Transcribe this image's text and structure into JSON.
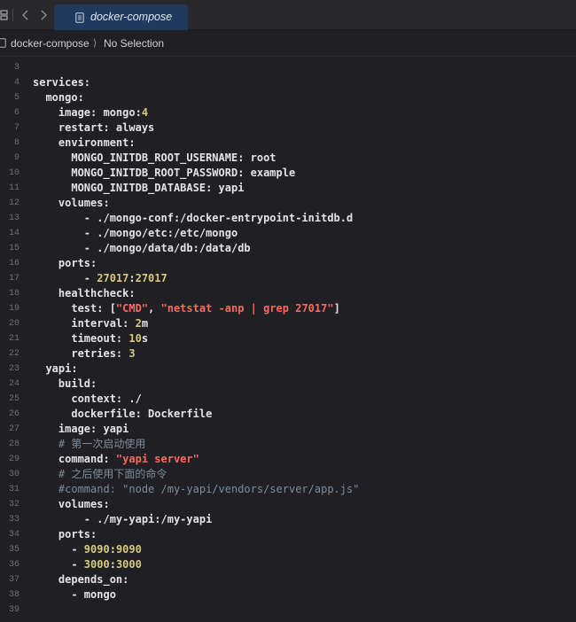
{
  "tab": {
    "title": "docker-compose"
  },
  "breadcrumb": {
    "file": "docker-compose",
    "separator": "⟩",
    "selection": "No Selection"
  },
  "lines": [
    {
      "no": "3",
      "segs": []
    },
    {
      "no": "4",
      "segs": [
        {
          "t": "services:",
          "k": "p"
        }
      ]
    },
    {
      "no": "5",
      "segs": [
        {
          "t": "  mongo:",
          "k": "p"
        }
      ]
    },
    {
      "no": "6",
      "segs": [
        {
          "t": "    image: mongo:",
          "k": "p"
        },
        {
          "t": "4",
          "k": "n"
        }
      ]
    },
    {
      "no": "7",
      "segs": [
        {
          "t": "    restart: always",
          "k": "p"
        }
      ]
    },
    {
      "no": "8",
      "segs": [
        {
          "t": "    environment:",
          "k": "p"
        }
      ]
    },
    {
      "no": "9",
      "segs": [
        {
          "t": "      MONGO_INITDB_ROOT_USERNAME: root",
          "k": "p"
        }
      ]
    },
    {
      "no": "10",
      "segs": [
        {
          "t": "      MONGO_INITDB_ROOT_PASSWORD: example",
          "k": "p"
        }
      ]
    },
    {
      "no": "11",
      "segs": [
        {
          "t": "      MONGO_INITDB_DATABASE: yapi",
          "k": "p"
        }
      ]
    },
    {
      "no": "12",
      "segs": [
        {
          "t": "    volumes:",
          "k": "p"
        }
      ]
    },
    {
      "no": "13",
      "segs": [
        {
          "t": "        - ./mongo-conf:/docker-entrypoint-initdb.d",
          "k": "p"
        }
      ]
    },
    {
      "no": "14",
      "segs": [
        {
          "t": "        - ./mongo/etc:/etc/mongo",
          "k": "p"
        }
      ]
    },
    {
      "no": "15",
      "segs": [
        {
          "t": "        - ./mongo/data/db:/data/db",
          "k": "p"
        }
      ]
    },
    {
      "no": "16",
      "segs": [
        {
          "t": "    ports:",
          "k": "p"
        }
      ]
    },
    {
      "no": "17",
      "segs": [
        {
          "t": "        - ",
          "k": "p"
        },
        {
          "t": "27017",
          "k": "n"
        },
        {
          "t": ":",
          "k": "p"
        },
        {
          "t": "27017",
          "k": "n"
        }
      ]
    },
    {
      "no": "18",
      "segs": [
        {
          "t": "    healthcheck:",
          "k": "p"
        }
      ]
    },
    {
      "no": "19",
      "segs": [
        {
          "t": "      test: [",
          "k": "p"
        },
        {
          "t": "\"CMD\"",
          "k": "s"
        },
        {
          "t": ", ",
          "k": "p"
        },
        {
          "t": "\"netstat -anp | grep 27017\"",
          "k": "s"
        },
        {
          "t": "]",
          "k": "p"
        }
      ]
    },
    {
      "no": "20",
      "segs": [
        {
          "t": "      interval: ",
          "k": "p"
        },
        {
          "t": "2",
          "k": "n"
        },
        {
          "t": "m",
          "k": "p"
        }
      ]
    },
    {
      "no": "21",
      "segs": [
        {
          "t": "      timeout: ",
          "k": "p"
        },
        {
          "t": "10",
          "k": "n"
        },
        {
          "t": "s",
          "k": "p"
        }
      ]
    },
    {
      "no": "22",
      "segs": [
        {
          "t": "      retries: ",
          "k": "p"
        },
        {
          "t": "3",
          "k": "n"
        }
      ]
    },
    {
      "no": "23",
      "segs": [
        {
          "t": "  yapi:",
          "k": "p"
        }
      ]
    },
    {
      "no": "24",
      "segs": [
        {
          "t": "    build:",
          "k": "p"
        }
      ]
    },
    {
      "no": "25",
      "segs": [
        {
          "t": "      context: ./",
          "k": "p"
        }
      ]
    },
    {
      "no": "26",
      "segs": [
        {
          "t": "      dockerfile: Dockerfile",
          "k": "p"
        }
      ]
    },
    {
      "no": "27",
      "segs": [
        {
          "t": "    image: yapi",
          "k": "p"
        }
      ]
    },
    {
      "no": "28",
      "segs": [
        {
          "t": "    # 第一次启动使用",
          "k": "c"
        }
      ]
    },
    {
      "no": "29",
      "segs": [
        {
          "t": "    command: ",
          "k": "p"
        },
        {
          "t": "\"yapi server\"",
          "k": "s"
        }
      ]
    },
    {
      "no": "30",
      "segs": [
        {
          "t": "    # 之后使用下面的命令",
          "k": "c"
        }
      ]
    },
    {
      "no": "31",
      "segs": [
        {
          "t": "    #command: \"node /my-yapi/vendors/server/app.js\"",
          "k": "c"
        }
      ]
    },
    {
      "no": "32",
      "segs": [
        {
          "t": "    volumes:",
          "k": "p"
        }
      ]
    },
    {
      "no": "33",
      "segs": [
        {
          "t": "        - ./my-yapi:/my-yapi",
          "k": "p"
        }
      ]
    },
    {
      "no": "34",
      "segs": [
        {
          "t": "    ports:",
          "k": "p"
        }
      ]
    },
    {
      "no": "35",
      "segs": [
        {
          "t": "      - ",
          "k": "p"
        },
        {
          "t": "9090",
          "k": "n"
        },
        {
          "t": ":",
          "k": "p"
        },
        {
          "t": "9090",
          "k": "n"
        }
      ]
    },
    {
      "no": "36",
      "segs": [
        {
          "t": "      - ",
          "k": "p"
        },
        {
          "t": "3000",
          "k": "n"
        },
        {
          "t": ":",
          "k": "p"
        },
        {
          "t": "3000",
          "k": "n"
        }
      ]
    },
    {
      "no": "37",
      "segs": [
        {
          "t": "    depends_on:",
          "k": "p"
        }
      ]
    },
    {
      "no": "38",
      "segs": [
        {
          "t": "      - mongo",
          "k": "p"
        }
      ]
    },
    {
      "no": "39",
      "segs": []
    }
  ]
}
